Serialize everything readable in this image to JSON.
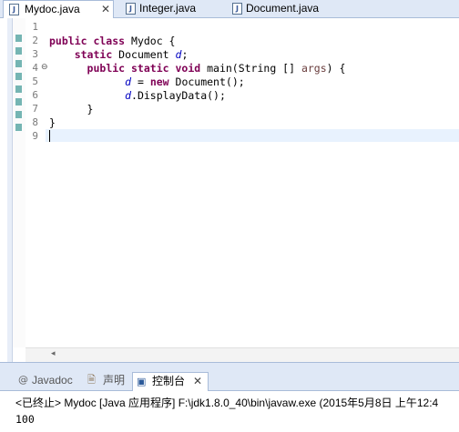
{
  "editor_tabs": [
    {
      "label": "Mydoc.java",
      "close": "✕",
      "icon": "java-file-icon"
    },
    {
      "label": "Integer.java",
      "icon": "java-file-icon"
    },
    {
      "label": "Document.java",
      "icon": "java-file-icon"
    }
  ],
  "line_numbers": [
    "1",
    "2",
    "3",
    "4",
    "5",
    "6",
    "7",
    "8",
    "9"
  ],
  "fold_marker": "⊖",
  "code": {
    "l2": {
      "kw": "public class",
      "rest": " Mydoc {"
    },
    "l3": {
      "kw": "static",
      "type": " Document ",
      "field": "d",
      "end": ";"
    },
    "l4": {
      "kw": "public static void",
      "rest": " main(String [] ",
      "param": "args",
      "end": ") {"
    },
    "l5": {
      "field": "d",
      "eq": " = ",
      "kw": "new",
      "rest": " Document();"
    },
    "l6": {
      "field": "d",
      "rest": ".DisplayData();"
    },
    "l7": "}",
    "l8": "}"
  },
  "scroll_left_arrow": "◂",
  "console_tabs": [
    {
      "label": "Javadoc",
      "icon": "at-sign-icon",
      "glyph": "@"
    },
    {
      "label": "声明",
      "icon": "declaration-icon",
      "glyph": "🗎"
    },
    {
      "label": "控制台",
      "icon": "console-icon",
      "glyph": "▣",
      "close": "✕"
    }
  ],
  "console": {
    "status": "<已终止> Mydoc [Java 应用程序] F:\\jdk1.8.0_40\\bin\\javaw.exe (2015年5月8日 上午12:4",
    "output": "100"
  },
  "colors": {
    "keyword": "#7f0055",
    "field": "#0000c0",
    "param": "#6a3e3e",
    "marker": "#75b5b3"
  }
}
